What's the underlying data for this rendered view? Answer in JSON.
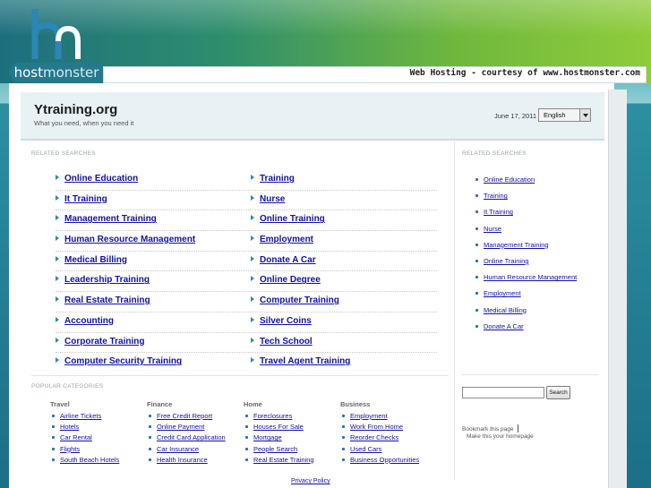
{
  "branding": {
    "logo_word_host": "host",
    "logo_word_monster": "monster",
    "courtesy": "Web Hosting - courtesy of www.hostmonster.com"
  },
  "site": {
    "title": "Ytraining.org",
    "tagline": "What you need, when you need it",
    "date": "June 17, 2011",
    "language": "English"
  },
  "related_label": "RELATED SEARCHES",
  "main_links": [
    [
      "Online Education",
      "Training"
    ],
    [
      "It Training",
      "Nurse"
    ],
    [
      "Management Training",
      "Online Training"
    ],
    [
      "Human Resource Management",
      "Employment"
    ],
    [
      "Medical Billing",
      "Donate A Car"
    ],
    [
      "Leadership Training",
      "Online Degree"
    ],
    [
      "Real Estate Training",
      "Computer Training"
    ],
    [
      "Accounting",
      "Silver Coins"
    ],
    [
      "Corporate Training",
      "Tech School"
    ],
    [
      "Computer Security Training",
      "Travel Agent Training"
    ]
  ],
  "side_label": "RELATED SEARCHES",
  "side_links": [
    "Online Education",
    "Training",
    "It Training",
    "Nurse",
    "Management Training",
    "Online Training",
    "Human Resource Management",
    "Employment",
    "Medical Billing",
    "Donate A Car"
  ],
  "popular_label": "POPULAR CATEGORIES",
  "popular": [
    {
      "heading": "Travel",
      "items": [
        "Airline Tickets",
        "Hotels",
        "Car Rental",
        "Flights",
        "South Beach Hotels"
      ]
    },
    {
      "heading": "Finance",
      "items": [
        "Free Credit Report",
        "Online Payment",
        "Credit Card Application",
        "Car Insurance",
        "Health Insurance"
      ]
    },
    {
      "heading": "Home",
      "items": [
        "Foreclosures",
        "Houses For Sale",
        "Mortgage",
        "People Search",
        "Real Estate Training"
      ]
    },
    {
      "heading": "Business",
      "items": [
        "Employment",
        "Work From Home",
        "Reorder Checks",
        "Used Cars",
        "Business Opportunities"
      ]
    }
  ],
  "search": {
    "button": "Search",
    "value": ""
  },
  "bookmark": "Bookmark this page",
  "homepage": "Make this your homepage",
  "privacy": "Privacy Policy",
  "colors": {
    "link": "#1111aa",
    "bullet": "#2a8ab0",
    "header_bg": "#e8f1f4"
  }
}
